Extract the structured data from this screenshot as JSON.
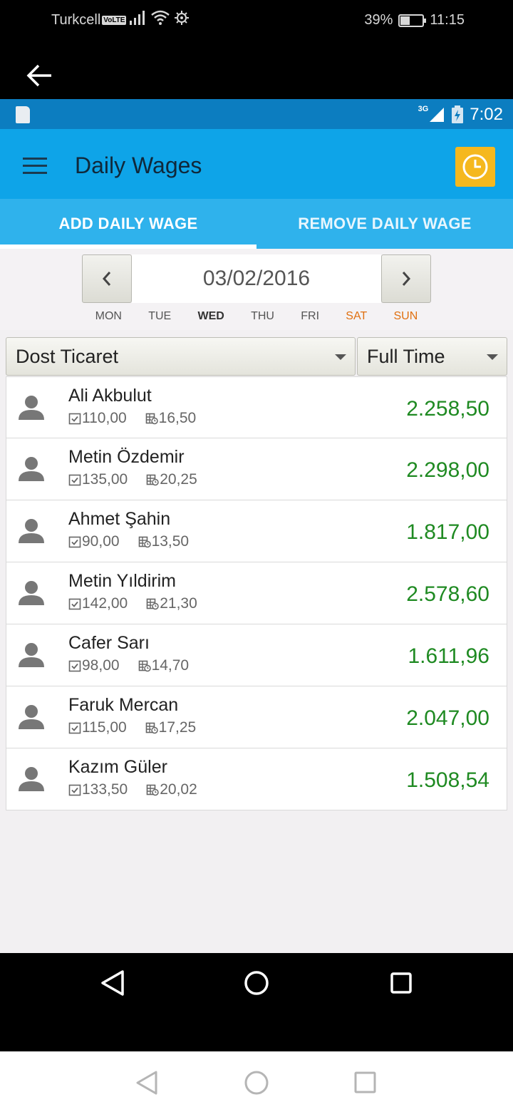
{
  "outer_status": {
    "carrier": "Turkcell",
    "volte": "VoLTE",
    "battery_percent": "39%",
    "battery_level": 0.39,
    "time": "11:15"
  },
  "inner_status": {
    "network": "3G",
    "time": "7:02"
  },
  "app_bar": {
    "title": "Daily Wages"
  },
  "tabs": [
    {
      "label": "ADD DAILY WAGE",
      "active": true
    },
    {
      "label": "REMOVE DAILY WAGE",
      "active": false
    }
  ],
  "date_picker": {
    "date": "03/02/2016",
    "days": [
      "MON",
      "TUE",
      "WED",
      "THU",
      "FRI",
      "SAT",
      "SUN"
    ],
    "selected_day": "WED"
  },
  "filters": {
    "company": "Dost Ticaret",
    "type": "Full Time"
  },
  "employees": [
    {
      "name": "Ali Akbulut",
      "daily": "110,00",
      "overtime": "16,50",
      "total": "2.258,50"
    },
    {
      "name": "Metin Özdemir",
      "daily": "135,00",
      "overtime": "20,25",
      "total": "2.298,00"
    },
    {
      "name": "Ahmet Şahin",
      "daily": "90,00",
      "overtime": "13,50",
      "total": "1.817,00"
    },
    {
      "name": "Metin Yıldirim",
      "daily": "142,00",
      "overtime": "21,30",
      "total": "2.578,60"
    },
    {
      "name": "Cafer Sarı",
      "daily": "98,00",
      "overtime": "14,70",
      "total": "1.611,96"
    },
    {
      "name": "Faruk Mercan",
      "daily": "115,00",
      "overtime": "17,25",
      "total": "2.047,00"
    },
    {
      "name": "Kazım Güler",
      "daily": "133,50",
      "overtime": "20,02",
      "total": "1.508,54"
    }
  ],
  "colors": {
    "app_bar": "#0ea4e8",
    "tabs": "#2fb2ec",
    "status_bar": "#0c7dc0",
    "clock_button": "#f5b81e",
    "amount_green": "#1f8a22",
    "weekend": "#e07010"
  }
}
